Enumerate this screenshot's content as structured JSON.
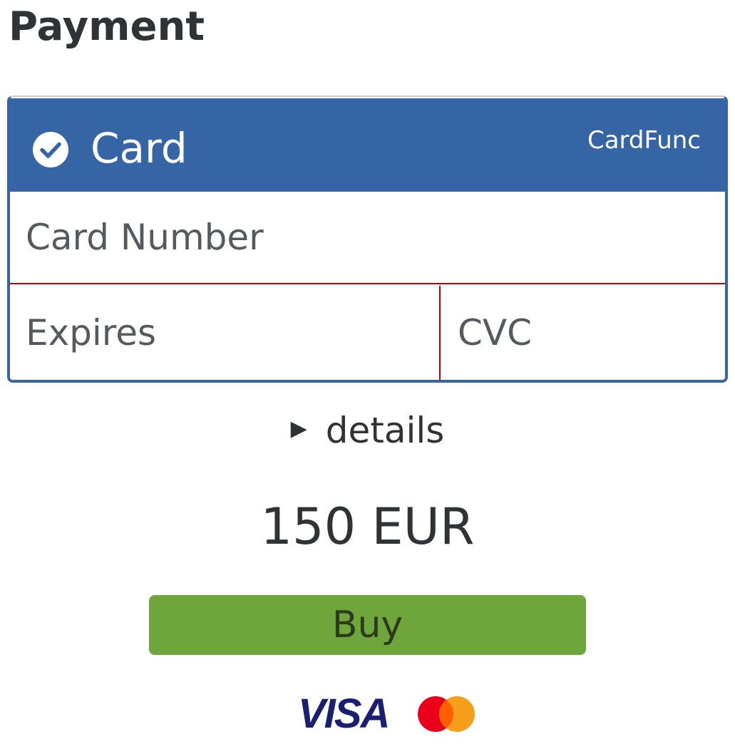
{
  "page": {
    "title": "Payment"
  },
  "card": {
    "title": "Card",
    "provider": "CardFunc",
    "number_placeholder": "Card Number",
    "expires_placeholder": "Expires",
    "cvc_placeholder": "CVC",
    "accent_color": "#3565a5",
    "error_border_color": "#c00000"
  },
  "details": {
    "label": "details"
  },
  "order": {
    "amount": "150 EUR"
  },
  "buy": {
    "label": "Buy",
    "color": "#6fa63b"
  },
  "brands": {
    "visa": "VISA",
    "mastercard_icon": "mastercard-icon"
  }
}
